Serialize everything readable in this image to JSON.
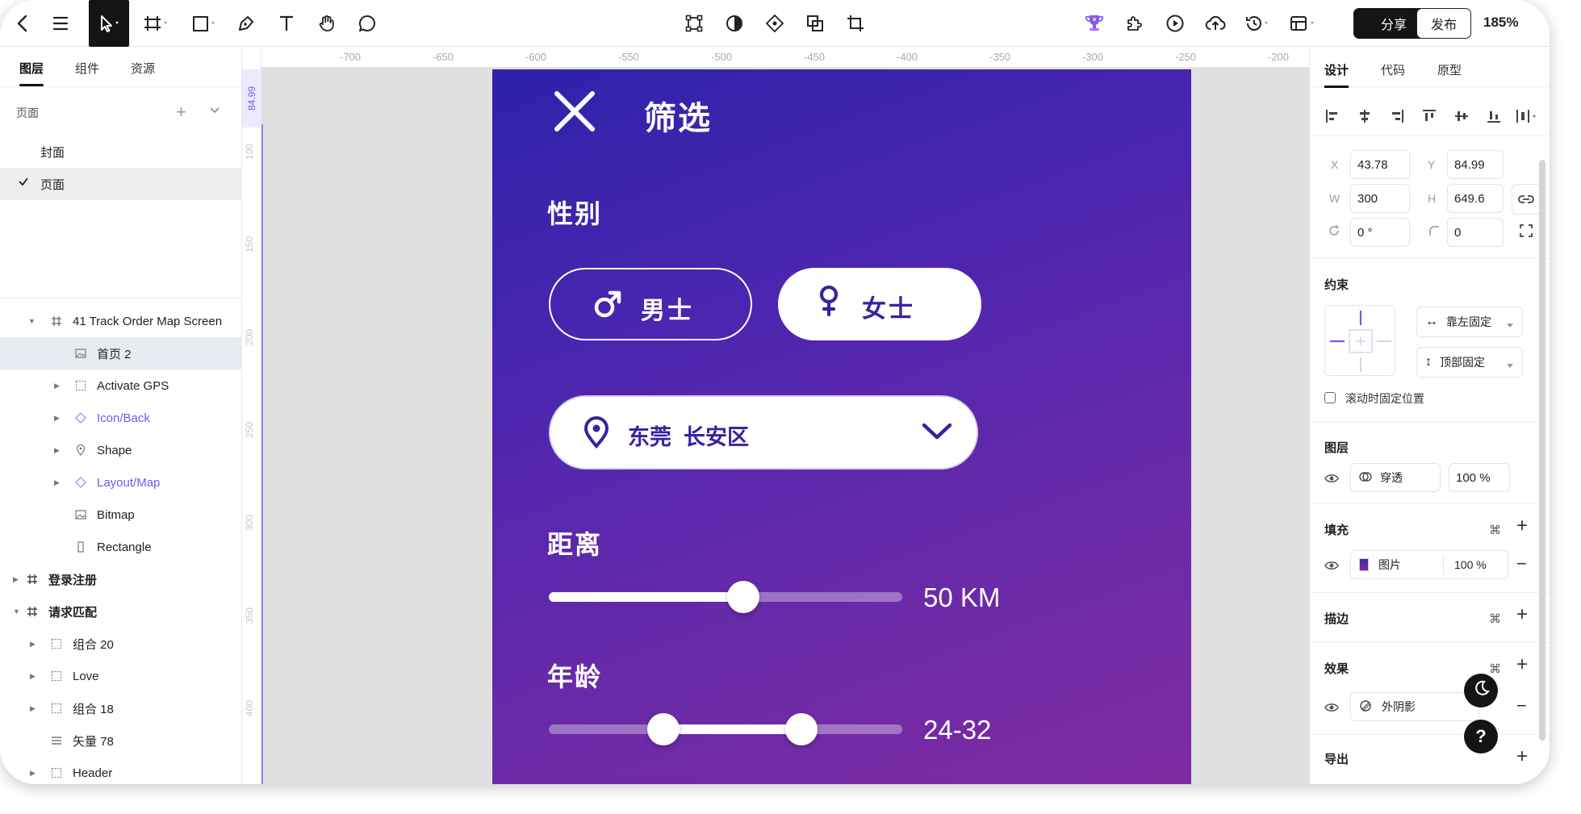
{
  "toolbar": {
    "share_label": "分享",
    "publish_label": "发布",
    "zoom": "185%"
  },
  "left_panel": {
    "tabs": [
      "图层",
      "组件",
      "资源"
    ],
    "pages_label": "页面",
    "pages": [
      "封面",
      "页面"
    ],
    "layers": [
      {
        "label": "41 Track Order Map Screen",
        "icon": "frame-icon"
      },
      {
        "label": "首页 2",
        "icon": "image-icon"
      },
      {
        "label": "Activate GPS",
        "icon": "group-icon"
      },
      {
        "label": "Icon/Back",
        "icon": "component-icon"
      },
      {
        "label": "Shape",
        "icon": "pin-icon"
      },
      {
        "label": "Layout/Map",
        "icon": "component-icon"
      },
      {
        "label": "Bitmap",
        "icon": "image-icon"
      },
      {
        "label": "Rectangle",
        "icon": "rectangle-icon"
      },
      {
        "label": "登录注册",
        "icon": "frame-icon"
      },
      {
        "label": "请求匹配",
        "icon": "frame-icon"
      },
      {
        "label": "组合 20",
        "icon": "group-icon"
      },
      {
        "label": "Love",
        "icon": "group-icon"
      },
      {
        "label": "组合 18",
        "icon": "group-icon"
      },
      {
        "label": "矢量 78",
        "icon": "vector-icon"
      },
      {
        "label": "Header",
        "icon": "group-icon"
      }
    ]
  },
  "rulers": {
    "horizontal": [
      "-700",
      "-650",
      "-600",
      "-550",
      "-500",
      "-450",
      "-400",
      "-350",
      "-300",
      "-250",
      "-200"
    ],
    "vertical": [
      "100",
      "150",
      "200",
      "250",
      "300",
      "350",
      "400"
    ],
    "vertical_highlight": "84.99"
  },
  "phone": {
    "title": "筛选",
    "gender_label": "性别",
    "male_label": "男士",
    "female_label": "女士",
    "location": "东莞  长安区",
    "distance_label": "距离",
    "distance_value": "50 KM",
    "distance_fraction": 0.55,
    "age_label": "年龄",
    "age_value": "24-32",
    "age_range_fraction": [
      0.325,
      0.715
    ]
  },
  "right_panel": {
    "tabs": [
      "设计",
      "代码",
      "原型"
    ],
    "x_label": "X",
    "x_value": "43.78",
    "y_label": "Y",
    "y_value": "84.99",
    "w_label": "W",
    "w_value": "300",
    "h_label": "H",
    "h_value": "649.6",
    "rotation_value": "0 °",
    "radius_value": "0",
    "constraints_label": "约束",
    "constraint_h": "靠左固定",
    "constraint_v": "顶部固定",
    "fix_scroll_label": "滚动时固定位置",
    "layer_label": "图层",
    "blend_mode": "穿透",
    "layer_opacity": "100 %",
    "fill_label": "填充",
    "fill_type": "图片",
    "fill_opacity": "100 %",
    "stroke_label": "描边",
    "effect_label": "效果",
    "effect_type": "外阴影",
    "export_label": "导出"
  },
  "help_label": "?"
}
